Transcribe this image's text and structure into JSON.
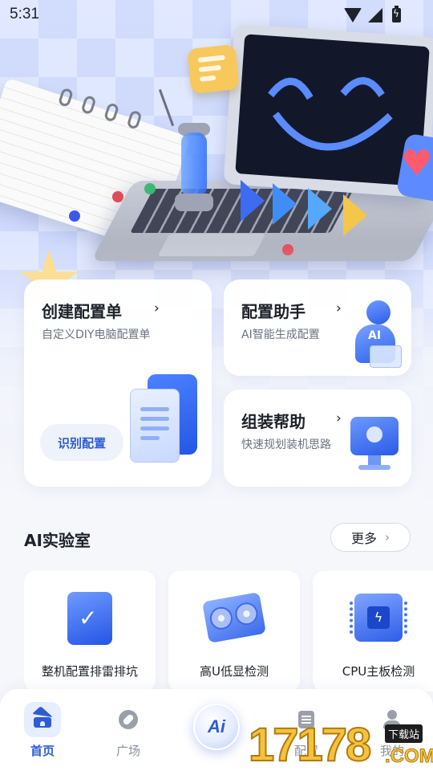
{
  "status_bar": {
    "time": "5:31"
  },
  "cards": {
    "create": {
      "title": "创建配置单",
      "subtitle": "自定义DIY电脑配置单",
      "action": "识别配置"
    },
    "assistant": {
      "title": "配置助手",
      "subtitle": "AI智能生成配置"
    },
    "help": {
      "title": "组装帮助",
      "subtitle": "快速规划装机思路"
    },
    "arrow": "›"
  },
  "ai_lab": {
    "title": "AI实验室",
    "more_label": "更多",
    "items": [
      {
        "label": "整机配置排雷排坑",
        "icon": "pc-case-check-icon"
      },
      {
        "label": "高U低显检测",
        "icon": "graphics-card-icon"
      },
      {
        "label": "CPU主板检测",
        "icon": "cpu-chip-icon"
      }
    ]
  },
  "nav": {
    "items": [
      {
        "label": "首页",
        "icon": "home-icon",
        "active": true
      },
      {
        "label": "广场",
        "icon": "compass-icon"
      },
      {
        "label": "",
        "icon": "ai-icon"
      },
      {
        "label": "配置",
        "icon": "list-icon"
      },
      {
        "label": "我的",
        "icon": "user-icon"
      }
    ],
    "ai_text": "Ai"
  },
  "watermark": {
    "digits": "17178",
    "tag": "下载站",
    "domain": ".COM"
  },
  "colors": {
    "accent": "#2f5cd6",
    "card_bg": "#ffffff",
    "page_bg": "#f6f7fb"
  }
}
